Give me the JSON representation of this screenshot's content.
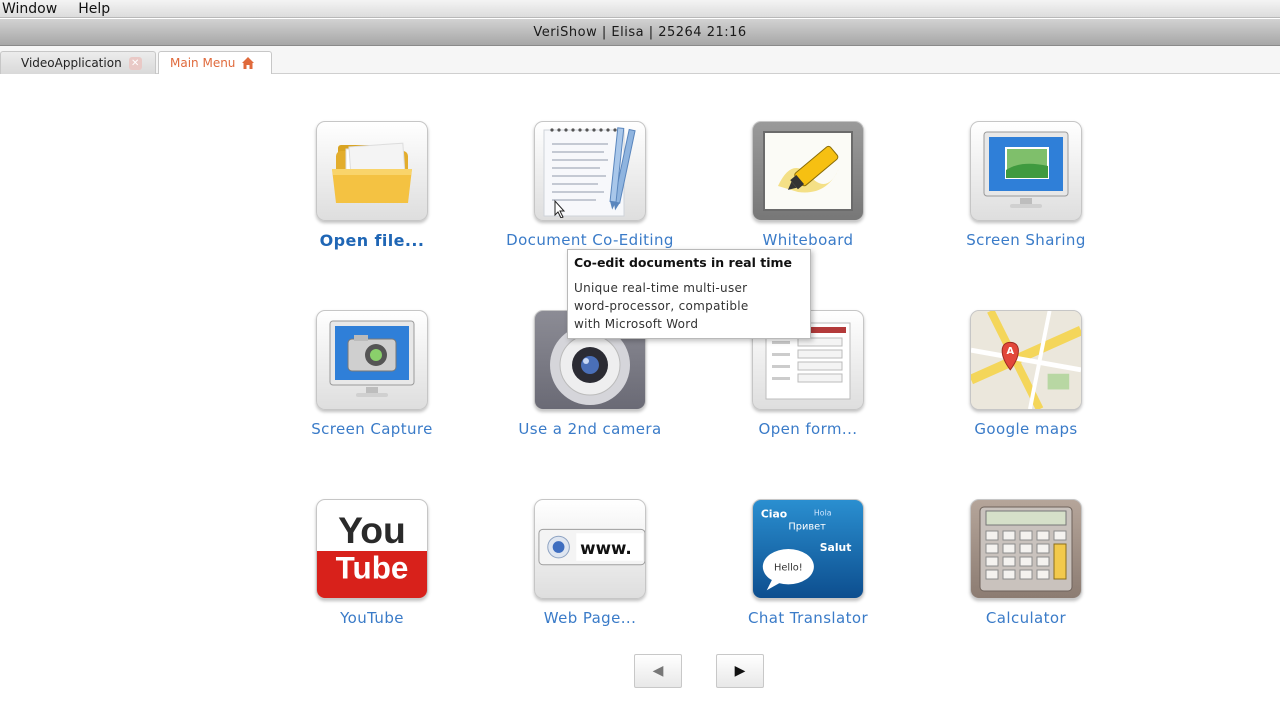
{
  "menubar": {
    "items": [
      "Window",
      "Help"
    ]
  },
  "window": {
    "title": "VeriShow | Elisa | 25264 21:16"
  },
  "tabs": [
    {
      "label": "VideoApplication",
      "close_glyph": "✕"
    },
    {
      "label": "Main Menu"
    }
  ],
  "apps": [
    {
      "label": "Open file..."
    },
    {
      "label": "Document Co-Editing"
    },
    {
      "label": "Whiteboard"
    },
    {
      "label": "Screen Sharing"
    },
    {
      "label": "Screen Capture"
    },
    {
      "label": "Use a 2nd camera"
    },
    {
      "label": "Open form..."
    },
    {
      "label": "Google maps"
    },
    {
      "label": "YouTube"
    },
    {
      "label": "Web Page..."
    },
    {
      "label": "Chat Translator"
    },
    {
      "label": "Calculator"
    }
  ],
  "youtube_icon": {
    "line1": "You",
    "line2": "Tube"
  },
  "webpage_icon": {
    "text": "www."
  },
  "translator_icon": {
    "words": [
      "Ciao",
      "Hola",
      "Привет",
      "Salut",
      "Hello!"
    ]
  },
  "maps_icon": {
    "marker": "A"
  },
  "tooltip": {
    "title": "Co-edit documents in real time",
    "body_lines": [
      "Unique real-time multi-user",
      "word-processor, compatible",
      "with Microsoft Word"
    ]
  },
  "pager": {
    "prev": "◀",
    "next": "▶"
  },
  "colors": {
    "label_link": "#3a7bc8",
    "tab_active": "#e06a3c"
  }
}
